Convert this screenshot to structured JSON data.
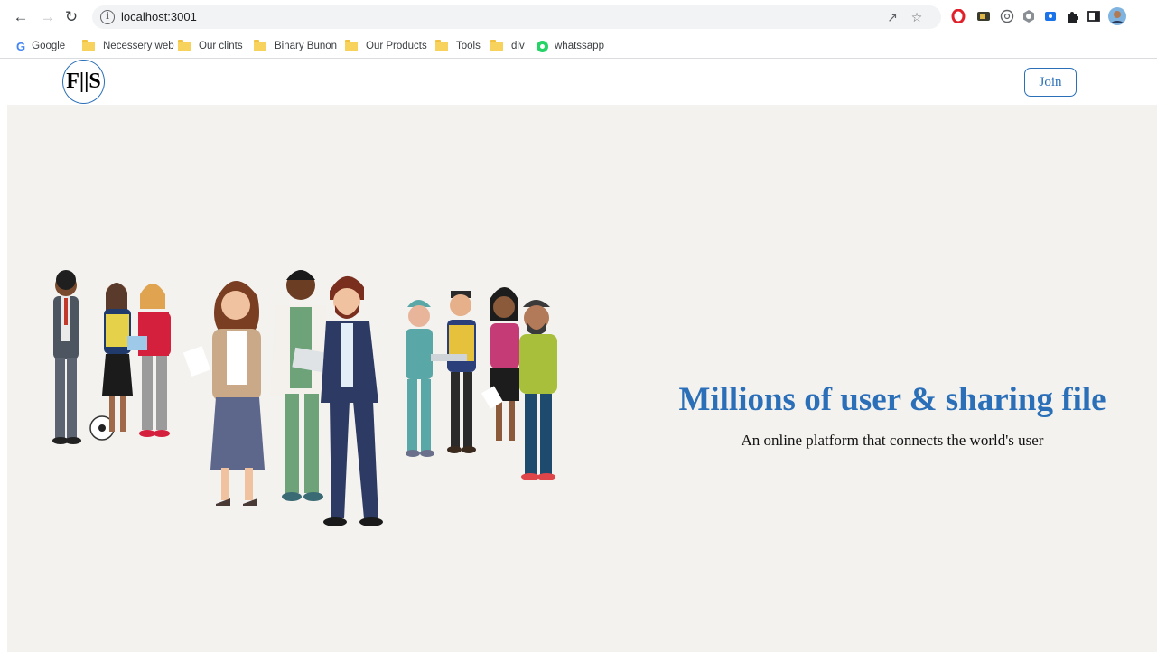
{
  "browser": {
    "url": "localhost:3001",
    "bookmarks": [
      {
        "label": "Google",
        "icon": "google-icon"
      },
      {
        "label": "Necessery web",
        "icon": "folder-icon"
      },
      {
        "label": "Our clints",
        "icon": "folder-icon"
      },
      {
        "label": "Binary Bunon",
        "icon": "folder-icon"
      },
      {
        "label": "Our Products",
        "icon": "folder-icon"
      },
      {
        "label": "Tools",
        "icon": "folder-icon"
      },
      {
        "label": "div",
        "icon": "folder-icon"
      },
      {
        "label": "whatssapp",
        "icon": "whatsapp-icon"
      }
    ]
  },
  "header": {
    "logo_text": "F||S",
    "join_label": "Join"
  },
  "hero": {
    "title": "Millions of user & sharing file",
    "subtitle": "An online platform that connects the world's user"
  },
  "colors": {
    "accent": "#2a6fb8",
    "hero_bg": "#f3f2ef"
  }
}
